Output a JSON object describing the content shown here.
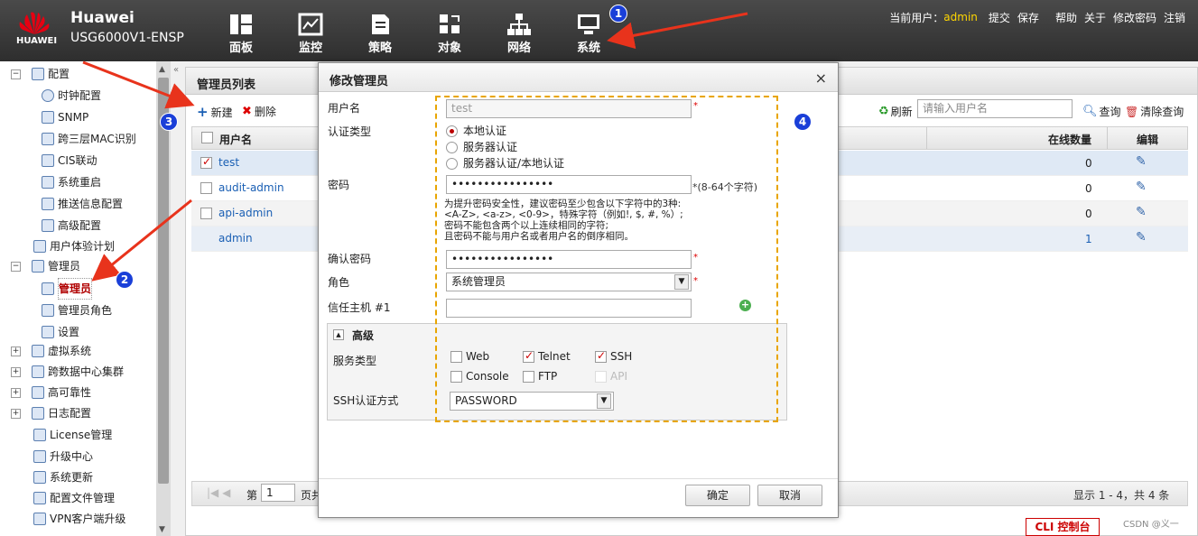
{
  "header": {
    "logo_text": "HUAWEI",
    "brand": "Huawei",
    "model": "USG6000V1-ENSP",
    "nav": [
      {
        "label": "面板",
        "icon": "dashboard-icon"
      },
      {
        "label": "监控",
        "icon": "monitor-icon"
      },
      {
        "label": "策略",
        "icon": "policy-icon"
      },
      {
        "label": "对象",
        "icon": "object-icon"
      },
      {
        "label": "网络",
        "icon": "network-icon"
      },
      {
        "label": "系统",
        "icon": "system-icon"
      }
    ],
    "current_user_label": "当前用户：",
    "current_user": "admin",
    "links": [
      "提交",
      "保存",
      "帮助",
      "关于",
      "修改密码",
      "注销"
    ]
  },
  "sidebar": {
    "items": [
      {
        "label": "配置"
      },
      {
        "label": "时钟配置"
      },
      {
        "label": "SNMP"
      },
      {
        "label": "跨三层MAC识别"
      },
      {
        "label": "CIS联动"
      },
      {
        "label": "系统重启"
      },
      {
        "label": "推送信息配置"
      },
      {
        "label": "高级配置"
      },
      {
        "label": "用户体验计划"
      },
      {
        "label": "管理员"
      },
      {
        "label": "管理员"
      },
      {
        "label": "管理员角色"
      },
      {
        "label": "设置"
      },
      {
        "label": "虚拟系统"
      },
      {
        "label": "跨数据中心集群"
      },
      {
        "label": "高可靠性"
      },
      {
        "label": "日志配置"
      },
      {
        "label": "License管理"
      },
      {
        "label": "升级中心"
      },
      {
        "label": "系统更新"
      },
      {
        "label": "配置文件管理"
      },
      {
        "label": "VPN客户端升级"
      }
    ]
  },
  "main": {
    "title": "管理员列表",
    "new_label": "新建",
    "delete_label": "删除",
    "refresh_label": "刷新",
    "search_placeholder": "请输入用户名",
    "query_label": "查询",
    "clear_query_label": "清除查询",
    "columns": {
      "username": "用户名",
      "online": "在线数量",
      "edit": "编辑"
    },
    "rows": [
      {
        "name": "test",
        "online": "0",
        "checked": true
      },
      {
        "name": "audit-admin",
        "online": "0",
        "checked": false
      },
      {
        "name": "api-admin",
        "online": "0",
        "checked": false
      },
      {
        "name": "admin",
        "online": "1",
        "checked": false
      }
    ],
    "pager": {
      "page_label": "第",
      "page_value": "1",
      "page_suffix": "页共",
      "summary": "显示 1 - 4，共 4 条"
    }
  },
  "dialog": {
    "title": "修改管理员",
    "username_label": "用户名",
    "username_value": "test",
    "auth_label": "认证类型",
    "auth_options": [
      "本地认证",
      "服务器认证",
      "服务器认证/本地认证"
    ],
    "password_label": "密码",
    "password_value": "••••••••••••••••",
    "password_hint": "*(8-64个字符)",
    "password_rules": [
      "为提升密码安全性，建议密码至少包含以下字符中的3种:",
      "<A-Z>, <a-z>, <0-9>，特殊字符（例如!, $, #, %）;",
      "密码不能包含两个以上连续相同的字符;",
      "且密码不能与用户名或者用户名的倒序相同。"
    ],
    "confirm_label": "确认密码",
    "confirm_value": "••••••••••••••••",
    "role_label": "角色",
    "role_value": "系统管理员",
    "trusted_label": "信任主机 #1",
    "advanced_label": "高级",
    "service_label": "服务类型",
    "services": [
      {
        "name": "Web",
        "checked": false,
        "disabled": false
      },
      {
        "name": "Telnet",
        "checked": true,
        "disabled": false
      },
      {
        "name": "SSH",
        "checked": true,
        "disabled": false
      },
      {
        "name": "Console",
        "checked": false,
        "disabled": false
      },
      {
        "name": "FTP",
        "checked": false,
        "disabled": false
      },
      {
        "name": "API",
        "checked": false,
        "disabled": true
      }
    ],
    "ssh_label": "SSH认证方式",
    "ssh_value": "PASSWORD",
    "ok_label": "确定",
    "cancel_label": "取消"
  },
  "badges": [
    "1",
    "2",
    "3",
    "4"
  ],
  "cli_label": "CLI 控制台",
  "watermark": "CSDN @义一",
  "colors": {
    "annotation_arrow": "#e8331c",
    "badge": "#1a3fd8",
    "highlight_box": "#e8a500"
  }
}
